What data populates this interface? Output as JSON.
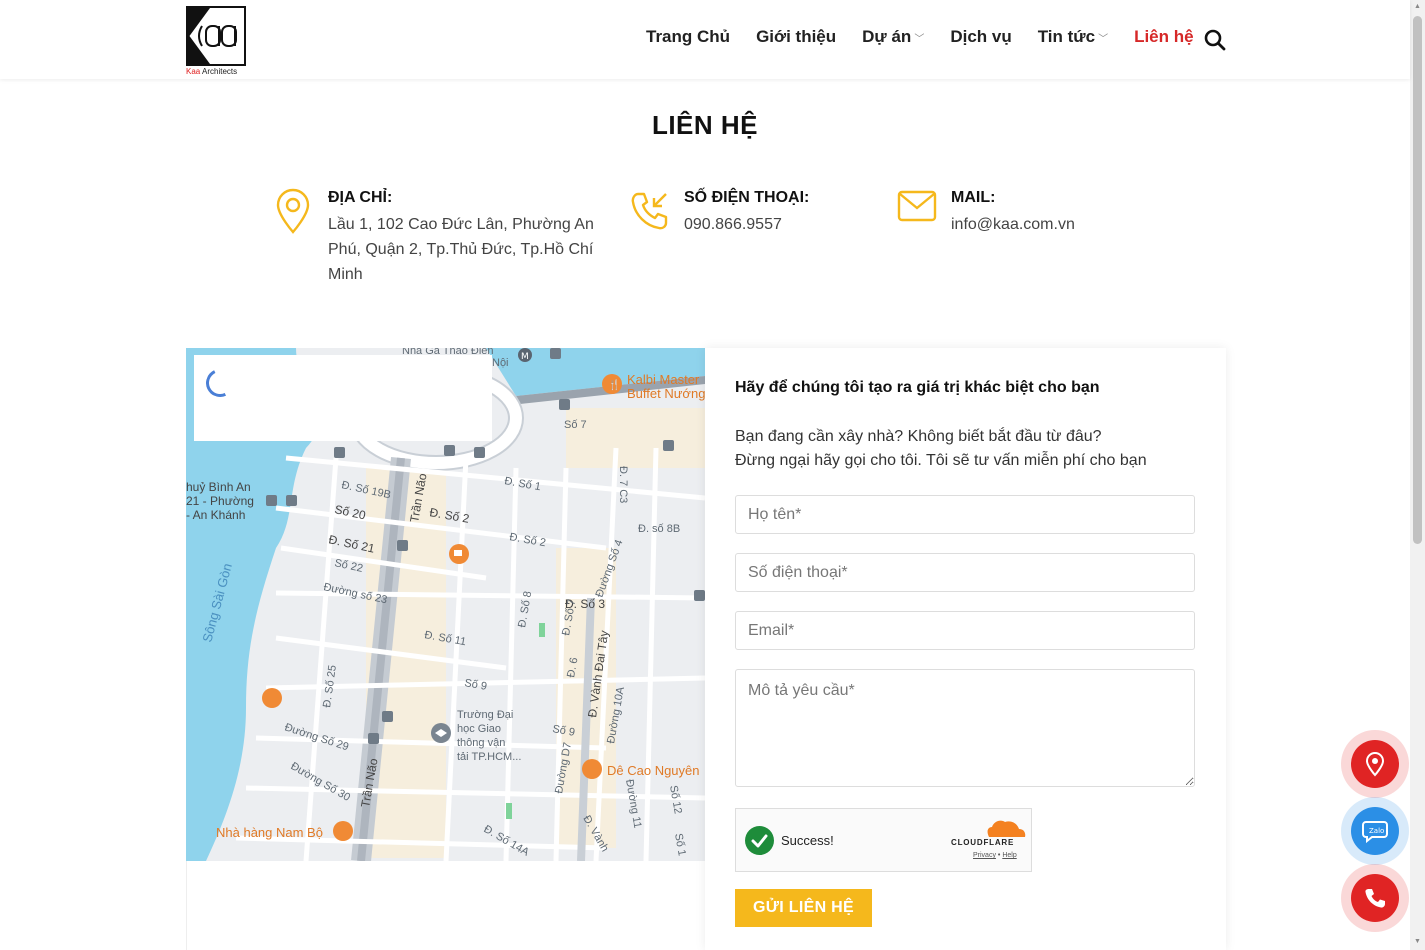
{
  "brand": {
    "logo_text": "Kaa Architects",
    "logo_initial": "Kaa"
  },
  "nav": {
    "items": [
      {
        "label": "Trang Chủ",
        "has_dropdown": false
      },
      {
        "label": "Giới thiệu",
        "has_dropdown": false
      },
      {
        "label": "Dự án",
        "has_dropdown": true
      },
      {
        "label": "Dịch vụ",
        "has_dropdown": false
      },
      {
        "label": "Tin tức",
        "has_dropdown": true
      },
      {
        "label": "Liên hệ",
        "has_dropdown": false,
        "active": true
      }
    ],
    "search_icon": "search-icon"
  },
  "page": {
    "title": "LIÊN HỆ"
  },
  "contact": {
    "address": {
      "label": "ĐỊA CHỈ:",
      "lines": [
        "Lầu 1, 102 Cao Đức Lân, Phường An",
        "Phú, Quận 2, Tp.Thủ Đức, Tp.Hồ Chí",
        "Minh"
      ],
      "icon": "location-pin-icon"
    },
    "phone": {
      "label": "SỐ ĐIỆN THOẠI:",
      "value": "090.866.9557",
      "icon": "phone-incoming-icon"
    },
    "mail": {
      "label": "MAIL:",
      "value": "info@kaa.com.vn",
      "icon": "envelope-icon"
    }
  },
  "map": {
    "labels": {
      "station": "Nhà Ga Thảo Điền",
      "noi": "Nội",
      "kalbi1": "Kalbi Master",
      "kalbi2": "Buffet Nướng",
      "so7": "Số 7",
      "thuy1": "huỷ Bình An",
      "thuy2": "21 - Phường",
      "thuy3": "- An Khánh",
      "river": "Sông Sài Gòn",
      "so19b": "Đ. Số 19B",
      "tran_nao1": "Trần Não",
      "so1": "Đ. Số 1",
      "c3": "Đ. 7 C3",
      "so20": "Số 20",
      "so2a": "Đ. Số 2",
      "so2b": "Đ. Số 2",
      "so8b": "Đ. số 8B",
      "so21": "Đ. Số 21",
      "so22": "Số 22",
      "so23": "Đường số 23",
      "so4": "Đường Số 4",
      "so3": "Đ. Số 3",
      "so8": "Đ. Số 8",
      "so7b": "Đ. Số 7",
      "vanhdai": "Đ. Vành Đai Tây",
      "so11": "Đ. Số 11",
      "so6": "Đ. 6",
      "so9a": "Số 9",
      "so25": "Đ. Số 25",
      "truong1": "Trường Đại",
      "truong2": "học Giao",
      "truong3": "thông vận",
      "truong4": "tải TP.HCM...",
      "so29": "Đường Số 29",
      "so9b": "Số 9",
      "d7": "Đường D7",
      "so10a": "Đường 10A",
      "so11b": "Đường 11",
      "decao": "Dê Cao Nguyên",
      "so30": "Đường Số 30",
      "tran_nao2": "Trần Não",
      "so12": "Số 12",
      "namBo": "Nhà hàng Nam Bộ",
      "so14a": "Đ. Số 14A",
      "vanh2": "Đ. Vành",
      "so16": "Số 1"
    }
  },
  "form": {
    "heading": "Hãy để chúng tôi tạo ra giá trị khác biệt cho bạn",
    "desc_line1": "Bạn đang cần xây nhà? Không biết bắt đầu từ đâu?",
    "desc_line2": "Đừng ngại hãy gọi cho tôi. Tôi sẽ tư vấn miễn phí cho bạn",
    "name_placeholder": "Họ tên*",
    "phone_placeholder": "Số điện thoại*",
    "email_placeholder": "Email*",
    "message_placeholder": "Mô tả yêu cầu*",
    "captcha_status": "Success!",
    "captcha_brand": "CLOUDFLARE",
    "captcha_privacy": "Privacy",
    "captcha_sep": "•",
    "captcha_help": "Help",
    "submit_label": "GỬI LIÊN HỆ"
  },
  "floating": [
    {
      "icon": "map-marker-icon",
      "color": "#e02424"
    },
    {
      "icon": "zalo-chat-icon",
      "color": "#2b8fe6"
    },
    {
      "icon": "phone-call-icon",
      "color": "#e02424"
    }
  ],
  "colors": {
    "accent": "#d62828",
    "button": "#f5b81c",
    "icon": "#f5b81c"
  }
}
